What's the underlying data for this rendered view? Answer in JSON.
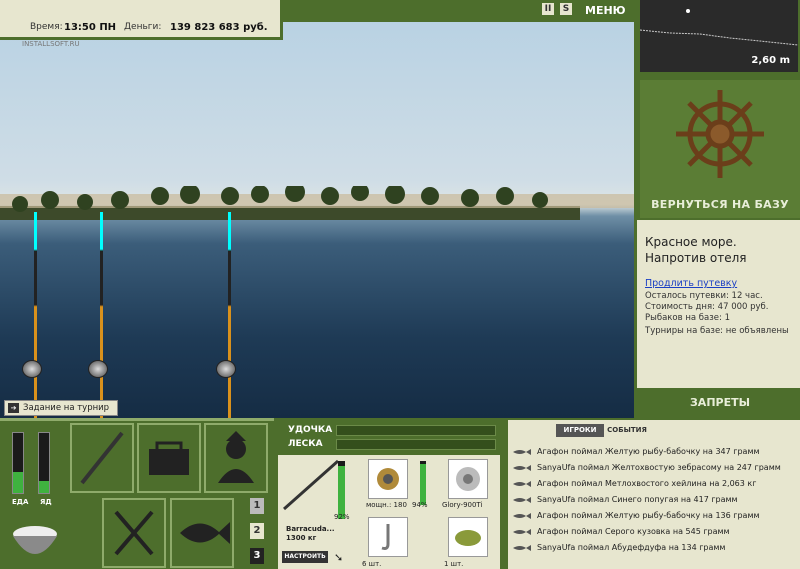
{
  "topbar": {
    "time_label": "Время:",
    "time_value": "13:50 ПН",
    "money_label": "Деньги:",
    "money_value": "139 823 683 руб.",
    "watermark": "INSTALLSOFT.RU"
  },
  "header": {
    "pause_icon": "II",
    "sound_icon": "S",
    "menu_label": "МЕНЮ"
  },
  "depth": {
    "value": "2,60 m"
  },
  "base": {
    "back_label": "ВЕРНУТЬСЯ НА БАЗУ",
    "bans_label": "ЗАПРЕТЫ"
  },
  "info": {
    "location": "Красное море. Напротив отеля",
    "extend_link": "Продлить путевку",
    "left": "Осталось путевки: 12 час.",
    "cost": "Стоимость дня: 47 000 руб.",
    "fishers": "Рыбаков на базе: 1",
    "tournaments": "Турниры на базе: не объявлены"
  },
  "task": {
    "label": "Задание на турнир"
  },
  "status": {
    "food_label": "ЕДА",
    "poison_label": "ЯД",
    "food_level": 0.35,
    "poison_level": 0.2
  },
  "slots_numbers": [
    "1",
    "2",
    "3"
  ],
  "tackle": {
    "rod_label": "УДОЧКА",
    "line_label": "ЛЕСКА",
    "rod_name": "Barracuda...",
    "rod_weight": "1300 кг",
    "rod_percent": "92%",
    "setup_label": "НАСТРОИТЬ",
    "reel_power": "мощн.: 180",
    "reel_percent": "94%",
    "line_name": "Glory-900Ti",
    "hooks_count": "6 шт.",
    "bait_count": "1 шт."
  },
  "events": {
    "tab_players": "ИГРОКИ",
    "tab_events": "СОБЫТИЯ",
    "items": [
      "Агафон поймал Желтую рыбу-бабочку на 347 грамм",
      "SanyaUfa поймал Желтохвостую зебрасому на 247 грамм",
      "Агафон поймал Метлохвостого хейлина на 2,063 кг",
      "SanyaUfa поймал Синего попугая на 417 грамм",
      "Агафон поймал Желтую рыбу-бабочку на 136 грамм",
      "Агафон поймал Серого кузовка на 545 грамм",
      "SanyaUfa поймал Абудефдуфа на 134 грамм"
    ]
  }
}
